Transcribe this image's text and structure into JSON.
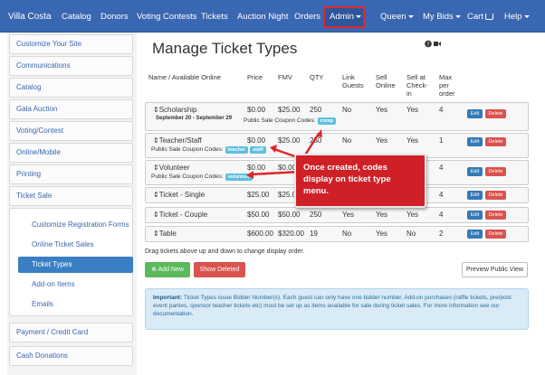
{
  "navbar": {
    "brand": "Villa Costa",
    "items": [
      "Catalog",
      "Donors",
      "Voting Contests",
      "Tickets",
      "Auction Night",
      "Orders"
    ],
    "admin": "Admin",
    "user": "Queen",
    "my_bids": "My Bids",
    "cart": "Cart",
    "help": "Help"
  },
  "sidebar": {
    "items": [
      "Customize Your Site",
      "Communications",
      "Catalog",
      "Gala Auction",
      "Voting/Contest",
      "Online/Mobile",
      "Printing",
      "Ticket Sale"
    ],
    "ticket_sale_subitems": [
      "Customize Registration Forms",
      "Online Ticket Sales",
      "Ticket Types",
      "Add-on Items",
      "Emails"
    ],
    "active_subitem": "Ticket Types",
    "bottom_items": [
      "Payment / Credit Card",
      "Cash Donations"
    ]
  },
  "main": {
    "title": "Manage Ticket Types",
    "title_icons": [
      "help-icon",
      "video-icon"
    ],
    "columns": {
      "name": "Name / Available Online",
      "price": "Price",
      "fmv": "FMV",
      "qty": "QTY",
      "link_guests": [
        "Link",
        "Guests"
      ],
      "sell_online": [
        "Sell",
        "Online"
      ],
      "sell_checkin": [
        "Sell at",
        "Check-",
        "in"
      ],
      "max_per_order": [
        "Max",
        "per",
        "order"
      ]
    },
    "coupon_label": "Public Sale Coupon Codes:",
    "edit_label": "Edit",
    "delete_label": "Delete",
    "rows": [
      {
        "name": "Scholarship",
        "price": "$0.00",
        "fmv": "$25.00",
        "qty": "250",
        "link": "No",
        "online": "Yes",
        "checkin": "Yes",
        "max": "4",
        "dates": "September 20 - September 29",
        "coupons": [
          "comp"
        ]
      },
      {
        "name": "Teacher/Staff",
        "price": "$0.00",
        "fmv": "$25.00",
        "qty": "250",
        "link": "No",
        "online": "Yes",
        "checkin": "Yes",
        "max": "1",
        "coupons": [
          "teacher",
          "staff"
        ]
      },
      {
        "name": "Volunteer",
        "price": "$0.00",
        "fmv": "$0.00",
        "qty": "",
        "link": "",
        "online": "",
        "checkin": "",
        "max": "4",
        "coupons": [
          "volunteer"
        ]
      },
      {
        "name": "Ticket - Single",
        "price": "$25.00",
        "fmv": "$25.00",
        "qty": "",
        "link": "",
        "online": "",
        "checkin": "",
        "max": "4"
      },
      {
        "name": "Ticket - Couple",
        "price": "$50.00",
        "fmv": "$50.00",
        "qty": "250",
        "link": "Yes",
        "online": "Yes",
        "checkin": "Yes",
        "max": "4"
      },
      {
        "name": "Table",
        "price": "$600.00",
        "fmv": "$320.00",
        "qty": "19",
        "link": "No",
        "online": "Yes",
        "checkin": "No",
        "max": "2"
      }
    ],
    "drag_note": "Drag tickets above up and down to change display order.",
    "add_button": "Add New",
    "show_deleted_button": "Show Deleted",
    "preview_button": "Preview Public View",
    "info": {
      "label": "Important:",
      "text": "Ticket Types issue Bidder Number(s). Each guest can only have one bidder number. Add-on purchases (raffle tickets, pre/post event parties, sponsor teacher tickets etc) must be set up as items available for sale during ticket sales. For more information see our",
      "link": "documentation."
    }
  },
  "callout": {
    "text": "Once created, codes display on ticket type menu."
  },
  "colors": {
    "navbar": "#3a67b1",
    "admin_highlight": "#e0252a",
    "callout": "#cf2027",
    "add": "#5cb85c",
    "delete": "#d9534f",
    "edit": "#337ab7",
    "tag": "#5bc0de"
  }
}
